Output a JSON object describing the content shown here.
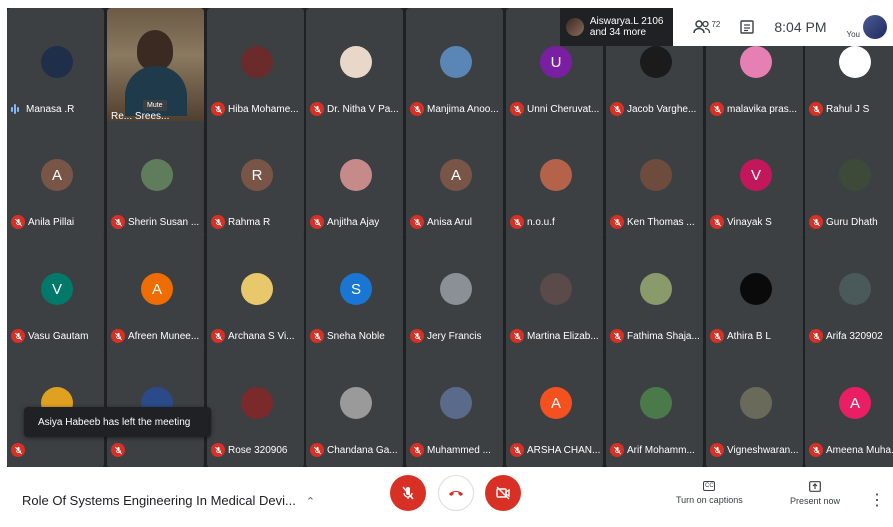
{
  "topbar": {
    "notification_line1": "Aiswarya.L 2106",
    "notification_line2": "and 34 more",
    "participants_count": "72",
    "clock": "8:04 PM",
    "you_label": "You"
  },
  "speaker_video": {
    "name": "Re... Srees...",
    "mute_tooltip": "Mute"
  },
  "participants": [
    {
      "name": "Manasa .R",
      "initial": "",
      "avatar_color": "#1f2f4a",
      "muted": false,
      "speaking": true
    },
    {
      "name": "",
      "initial": "",
      "avatar_color": "",
      "muted": false,
      "video": true
    },
    {
      "name": "Hiba Mohame...",
      "initial": "",
      "avatar_color": "#6b2b2b",
      "muted": true
    },
    {
      "name": "Dr. Nitha V Pa...",
      "initial": "",
      "avatar_color": "#e9d7c9",
      "muted": true
    },
    {
      "name": "Manjima Anoo...",
      "initial": "",
      "avatar_color": "#5a86b5",
      "muted": true
    },
    {
      "name": "Unni Cheruvat...",
      "initial": "U",
      "avatar_color": "#7b1fa2",
      "muted": true
    },
    {
      "name": "Jacob Varghe...",
      "initial": "",
      "avatar_color": "#1b1b1b",
      "muted": true
    },
    {
      "name": "malavika pras...",
      "initial": "",
      "avatar_color": "#e57fb4",
      "muted": true
    },
    {
      "name": "Rahul J S",
      "initial": "",
      "avatar_color": "#ffffff",
      "muted": true
    },
    {
      "name": "Anila Pillai",
      "initial": "A",
      "avatar_color": "#795548",
      "muted": true
    },
    {
      "name": "Sherin Susan ...",
      "initial": "",
      "avatar_color": "#5f7d5a",
      "muted": true
    },
    {
      "name": "Rahma R",
      "initial": "R",
      "avatar_color": "#795548",
      "muted": true
    },
    {
      "name": "Anjitha Ajay",
      "initial": "",
      "avatar_color": "#c68a8a",
      "muted": true
    },
    {
      "name": "Anisa Arul",
      "initial": "A",
      "avatar_color": "#795548",
      "muted": true
    },
    {
      "name": "n.o.u.f",
      "initial": "",
      "avatar_color": "#b5624a",
      "muted": true
    },
    {
      "name": "Ken Thomas ...",
      "initial": "",
      "avatar_color": "#6d4c3d",
      "muted": true
    },
    {
      "name": "Vinayak S",
      "initial": "V",
      "avatar_color": "#c2185b",
      "muted": true
    },
    {
      "name": "Guru Dhath",
      "initial": "",
      "avatar_color": "#3d4a3a",
      "muted": true
    },
    {
      "name": "Vasu Gautam",
      "initial": "V",
      "avatar_color": "#00796b",
      "muted": true
    },
    {
      "name": "Afreen Munee...",
      "initial": "A",
      "avatar_color": "#ef6c00",
      "muted": true
    },
    {
      "name": "Archana S Vi...",
      "initial": "",
      "avatar_color": "#e8c86a",
      "muted": true
    },
    {
      "name": "Sneha Noble",
      "initial": "S",
      "avatar_color": "#1976d2",
      "muted": true
    },
    {
      "name": "Jery Francis",
      "initial": "",
      "avatar_color": "#8a9096",
      "muted": true
    },
    {
      "name": "Martina Elizab...",
      "initial": "",
      "avatar_color": "#5a4a4a",
      "muted": true
    },
    {
      "name": "Fathima Shaja...",
      "initial": "",
      "avatar_color": "#8a9a6a",
      "muted": true
    },
    {
      "name": "Athira B L",
      "initial": "",
      "avatar_color": "#0a0a0a",
      "muted": true
    },
    {
      "name": "Arifa 320902",
      "initial": "",
      "avatar_color": "#4a5a5a",
      "muted": true
    },
    {
      "name": "",
      "initial": "",
      "avatar_color": "#e0a020",
      "muted": true
    },
    {
      "name": "",
      "initial": "",
      "avatar_color": "#2b4a8a",
      "muted": true
    },
    {
      "name": "Rose 320906",
      "initial": "",
      "avatar_color": "#7a2a2a",
      "muted": true
    },
    {
      "name": "Chandana Ga...",
      "initial": "",
      "avatar_color": "#9a9a9a",
      "muted": true
    },
    {
      "name": "Muhammed ...",
      "initial": "",
      "avatar_color": "#5a6a8a",
      "muted": true
    },
    {
      "name": "ARSHA CHAN...",
      "initial": "A",
      "avatar_color": "#f4511e",
      "muted": true
    },
    {
      "name": "Arif Mohamm...",
      "initial": "",
      "avatar_color": "#4a7a4a",
      "muted": true
    },
    {
      "name": "Vigneshwaran...",
      "initial": "",
      "avatar_color": "#6a6a5a",
      "muted": true
    },
    {
      "name": "Ameena Muha...",
      "initial": "A",
      "avatar_color": "#e91e63",
      "muted": true
    }
  ],
  "toast": "Asiya Habeeb has left the meeting",
  "bottombar": {
    "meeting_title": "Role Of Systems Engineering In Medical Devi...",
    "captions_label": "Turn on captions",
    "captions_icon_text": "CC",
    "present_label": "Present now"
  },
  "colors": {
    "mute_red": "#d93025",
    "tile": "#3c4043",
    "stage": "#202124",
    "accent": "#8ab4f8"
  }
}
